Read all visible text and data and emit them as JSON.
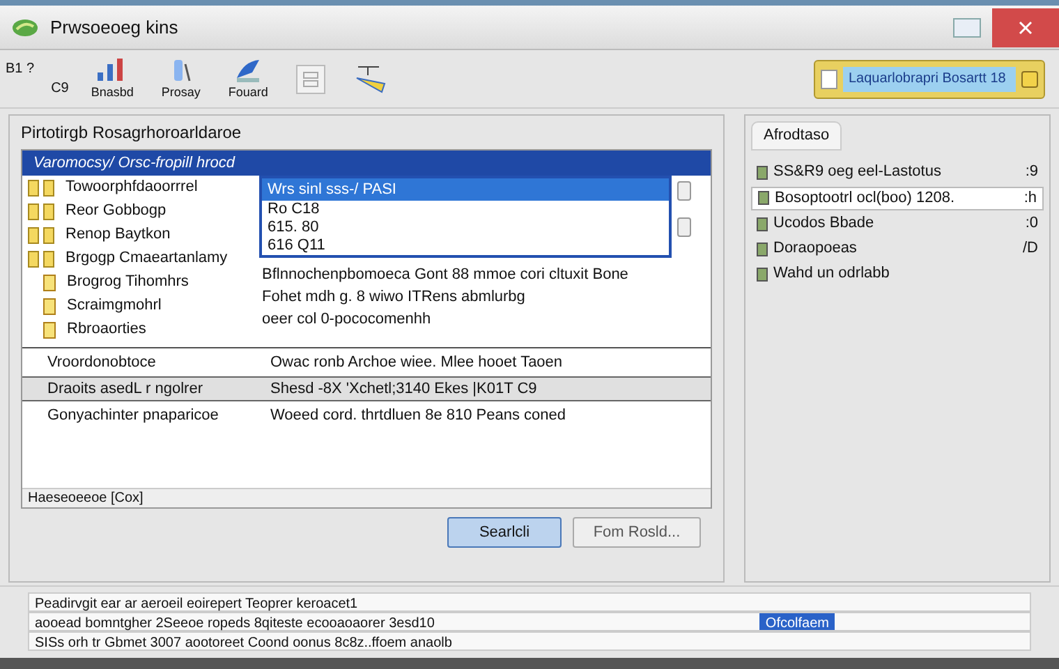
{
  "window": {
    "title": "Prwsoeoeg kins"
  },
  "toolbar": {
    "small_items": [
      {
        "top": "B1 ?",
        "bottom": "C9"
      }
    ],
    "tools": [
      {
        "label": "Bnasbd",
        "kind": "chart"
      },
      {
        "label": "Prosay",
        "kind": "bottle"
      },
      {
        "label": "Fouard",
        "kind": "pen"
      },
      {
        "kind": "box"
      },
      {
        "kind": "ruler"
      }
    ]
  },
  "search": {
    "value": "Laquarlobrapri Bosartt 18"
  },
  "left_panel": {
    "title": "Pirtotirgb Rosagrhoroarldaroe",
    "dialog": {
      "title": "Varomocsy/ Orsc-fropill hrocd",
      "tree": [
        {
          "label": "Towoorphfdaoorrrel",
          "kind": "folder2"
        },
        {
          "label": "Reor Gobbogp",
          "kind": "folder2"
        },
        {
          "label": "Renop Baytkon",
          "kind": "folder2"
        },
        {
          "label": "Brgogp Cmaeartanlamy",
          "kind": "folder2"
        },
        {
          "label": "Brogrog Tihomhrs",
          "kind": "file"
        },
        {
          "label": "Scraimgmohrl",
          "kind": "file"
        },
        {
          "label": "Rbroaorties",
          "kind": "file"
        }
      ],
      "dropdown": {
        "options": [
          {
            "label": "Wrs sinl sss-/ PASI",
            "selected": true
          },
          {
            "label": "Ro C18",
            "selected": false
          },
          {
            "label": "615. 80",
            "selected": false
          },
          {
            "label": "616 Q11",
            "selected": false
          }
        ]
      },
      "description": [
        "Bflnnochenpbomoeca Gont 88 mmoe cori cltuxit Bone",
        "Fohet mdh g. 8 wiwo ITRens abmlurbg",
        "oeer col 0-pococomenhh"
      ],
      "rows": [
        {
          "name": "Vroordonobtoce",
          "value": "Owac ronb Archoe wiee. Mlee hooet Taoen",
          "selected": false
        },
        {
          "name": "Draoits asedL r ngolrer",
          "value": "Shesd -8X 'Xchetl;3140 Ekes |K01T C9",
          "selected": true
        },
        {
          "name": "Gonyachinter pnaparicoe",
          "value": "Woeed cord. thrtdluen 8e 810 Peans coned",
          "selected": false
        }
      ],
      "scroll_label": "Haeseoeeoe [Cox]"
    },
    "buttons": [
      {
        "label": "Searlcli",
        "kind": "primary"
      },
      {
        "label": "Fom Rosld...",
        "kind": "secondary"
      }
    ]
  },
  "right_panel": {
    "tab": "Afrodtaso",
    "items": [
      {
        "label": "SS&R9 oeg eel-Lastotus",
        "suffix": ":9",
        "selected": false
      },
      {
        "label": "Bosoptootrl ocl(boo) 1208.",
        "suffix": ":h",
        "selected": true
      },
      {
        "label": "Ucodos Bbade",
        "suffix": ":0",
        "selected": false
      },
      {
        "label": "Doraopoeas",
        "suffix": "/D",
        "selected": false
      },
      {
        "label": "Wahd un odrlabb",
        "selected": false
      }
    ]
  },
  "status": {
    "lines": [
      "Peadirvgit ear ar aeroeil eoirepert Teoprer keroacet1",
      "aooead bomntgher 2Seeoe ropeds 8qiteste ecooaoaorer 3esd10",
      "SISs orh tr Gbmet 3007 aootoreet Coond oonus 8c8z..ffoem anaolb"
    ],
    "badge": "Ofcolfaem"
  }
}
